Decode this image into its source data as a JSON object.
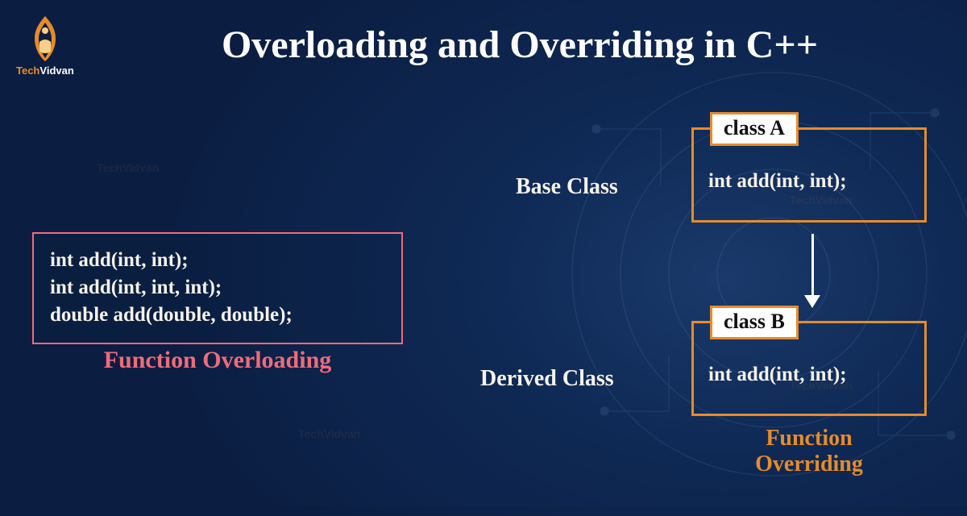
{
  "brand": {
    "name_part1": "Tech",
    "name_part2": "Vidvan"
  },
  "title": "Overloading and Overriding in C++",
  "overloading": {
    "lines": [
      "int add(int, int);",
      "int add(int, int, int);",
      "double add(double, double);"
    ],
    "caption": "Function Overloading"
  },
  "overriding": {
    "base_label": "Base Class",
    "derived_label": "Derived Class",
    "class_a": {
      "tag": "class A",
      "signature": "int add(int, int);"
    },
    "class_b": {
      "tag": "class B",
      "signature": "int add(int, int);"
    },
    "caption": "Function\nOverriding"
  },
  "colors": {
    "accent_orange": "#e78b2a",
    "accent_pink": "#f06b7a",
    "bg_dark": "#0b1e42"
  }
}
